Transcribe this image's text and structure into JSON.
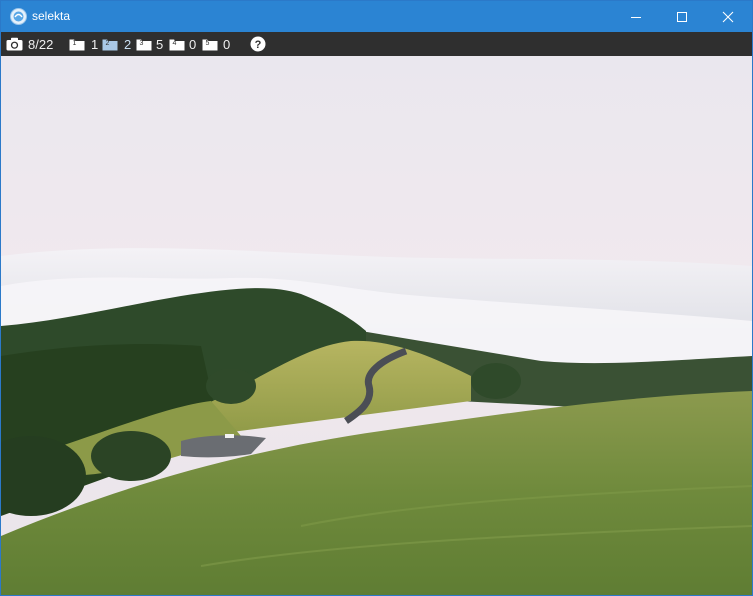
{
  "window": {
    "title": "selekta",
    "controls": [
      "minimize",
      "maximize",
      "close"
    ]
  },
  "toolbar": {
    "image_counter": "8/22",
    "folders": [
      {
        "number": "1",
        "count": "1",
        "highlighted": false
      },
      {
        "number": "2",
        "count": "2",
        "highlighted": true
      },
      {
        "number": "3",
        "count": "5",
        "highlighted": false
      },
      {
        "number": "4",
        "count": "0",
        "highlighted": false
      },
      {
        "number": "5",
        "count": "0",
        "highlighted": false
      }
    ],
    "help_icon": "question-mark-circle-icon"
  },
  "colors": {
    "titlebar": "#2b84d3",
    "toolbar": "#2f2f2f",
    "folder_icon": "#ffffff",
    "folder_icon_highlighted": "#a9c8e6"
  }
}
